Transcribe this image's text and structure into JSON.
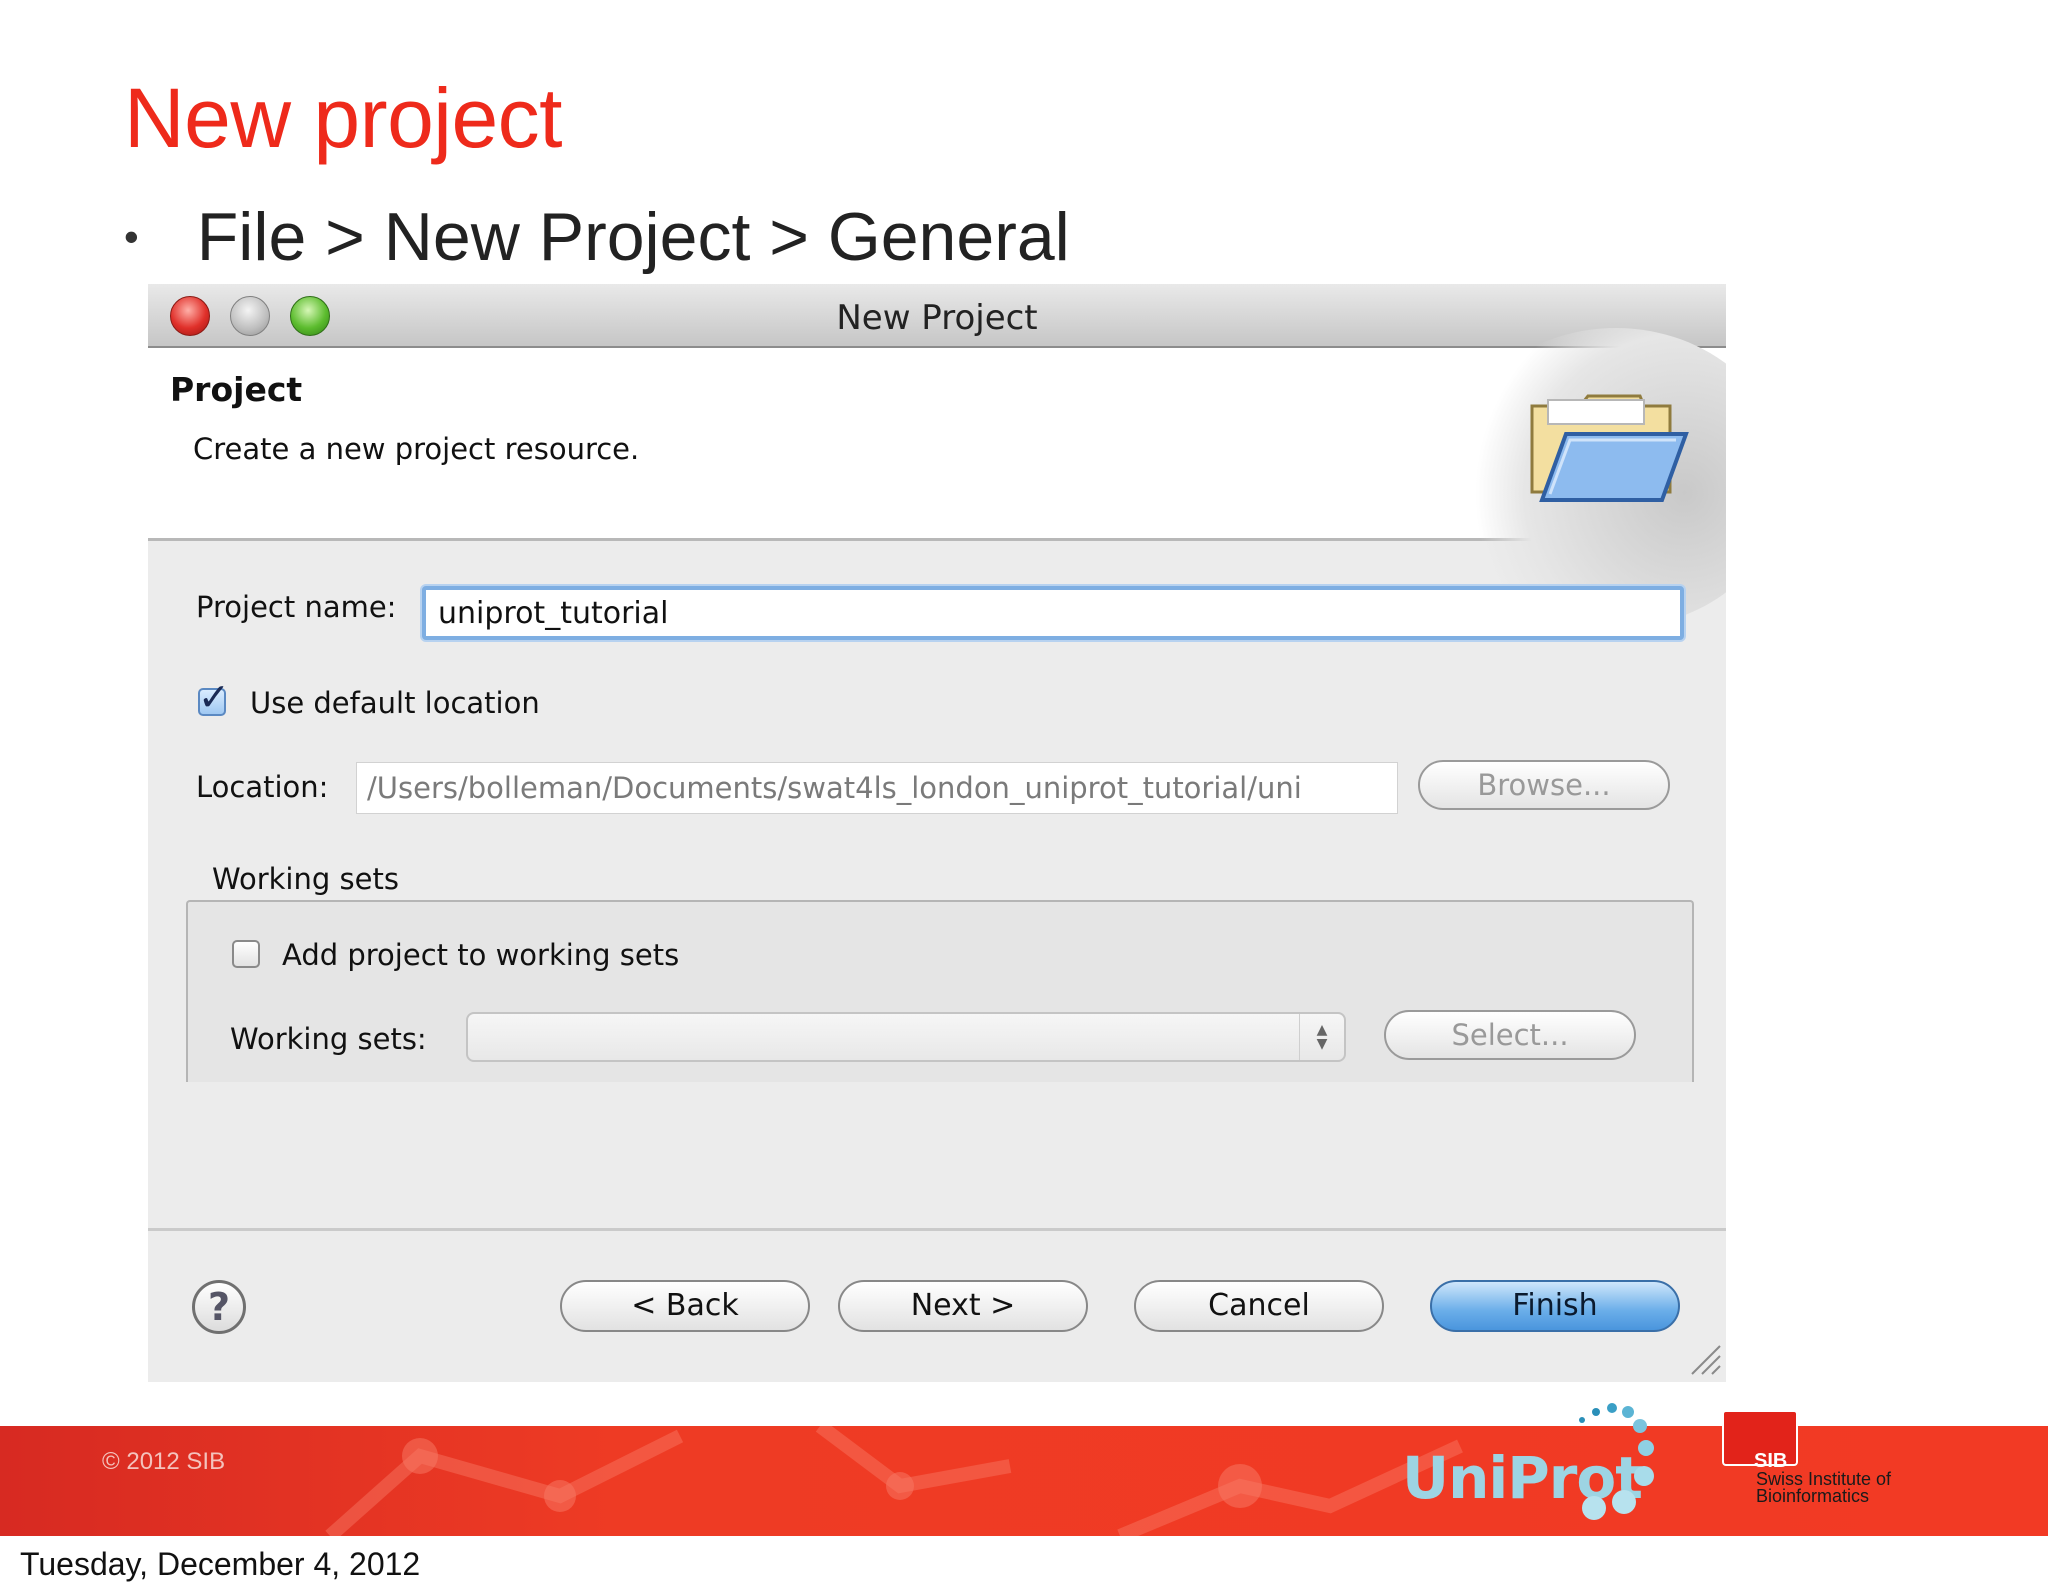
{
  "slide": {
    "title": "New project",
    "bullet": "File > New Project > General"
  },
  "dialog": {
    "window_title": "New Project",
    "header": {
      "title": "Project",
      "description": "Create a new project resource."
    },
    "project_name": {
      "label": "Project name:",
      "value": "uniprot_tutorial"
    },
    "use_default_location": {
      "label": "Use default location",
      "checked": true
    },
    "location": {
      "label": "Location:",
      "value": "/Users/bolleman/Documents/swat4ls_london_uniprot_tutorial/uni",
      "browse_label": "Browse..."
    },
    "working_sets_group": {
      "title": "Working sets",
      "add_label": "Add project to working sets",
      "add_checked": false,
      "combo_label": "Working sets:",
      "combo_value": "",
      "select_label": "Select..."
    },
    "buttons": {
      "back": "< Back",
      "next": "Next >",
      "cancel": "Cancel",
      "finish": "Finish"
    },
    "icons": {
      "help": "help-icon",
      "folder": "folder-icon",
      "resize": "resize-grip-icon"
    }
  },
  "footer": {
    "copyright": "© 2012 SIB",
    "uniprot_logo": "UniProt",
    "sib_badge": "SIB",
    "sib_name_line1": "Swiss Institute of",
    "sib_name_line2": "Bioinformatics",
    "date": "Tuesday, December 4, 2012"
  },
  "colors": {
    "title_red": "#ee2a1b",
    "footer_red": "#ee3b24",
    "focus_blue": "#7eaee2",
    "finish_blue": "#4a95dd"
  }
}
